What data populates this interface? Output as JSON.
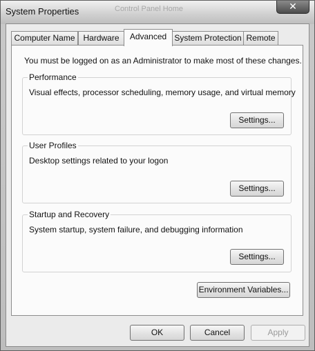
{
  "window": {
    "title": "System Properties",
    "background_title": "Control Panel Home",
    "close_glyph": "✕"
  },
  "tabs": [
    {
      "label": "Computer Name",
      "active": false
    },
    {
      "label": "Hardware",
      "active": false
    },
    {
      "label": "Advanced",
      "active": true
    },
    {
      "label": "System Protection",
      "active": false
    },
    {
      "label": "Remote",
      "active": false
    }
  ],
  "advanced": {
    "admin_notice": "You must be logged on as an Administrator to make most of these changes.",
    "performance": {
      "title": "Performance",
      "description": "Visual effects, processor scheduling, memory usage, and virtual memory",
      "button": "Settings..."
    },
    "user_profiles": {
      "title": "User Profiles",
      "description": "Desktop settings related to your logon",
      "button": "Settings..."
    },
    "startup_recovery": {
      "title": "Startup and Recovery",
      "description": "System startup, system failure, and debugging information",
      "button": "Settings..."
    },
    "environment_variables_button": "Environment Variables..."
  },
  "footer": {
    "ok": "OK",
    "cancel": "Cancel",
    "apply": "Apply",
    "apply_enabled": false
  }
}
